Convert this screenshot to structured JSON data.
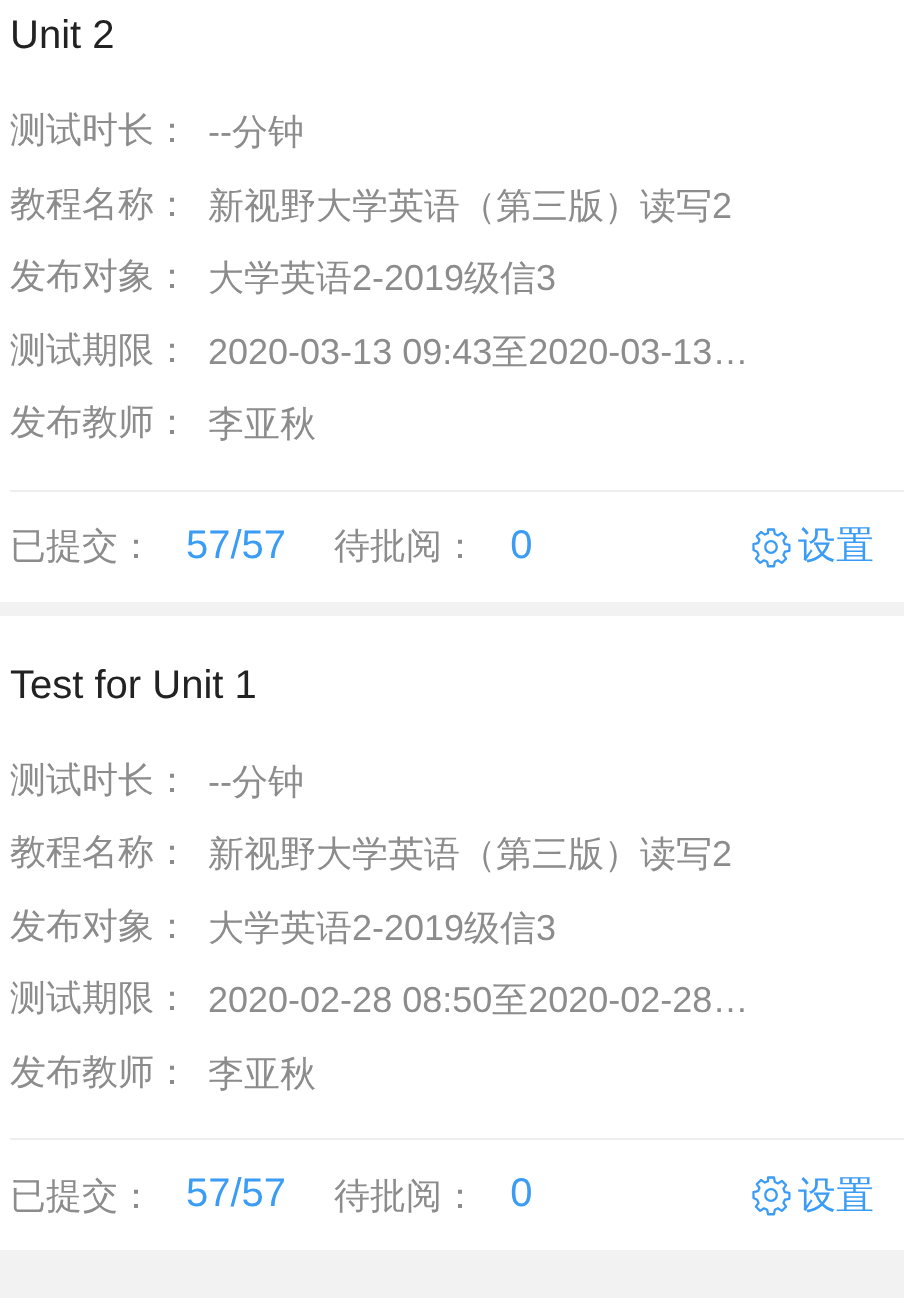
{
  "tests": [
    {
      "title": "Unit 2",
      "fields": [
        {
          "label": "测试时长：",
          "value": "--分钟"
        },
        {
          "label": "教程名称：",
          "value": "新视野大学英语（第三版）读写2"
        },
        {
          "label": "发布对象：",
          "value": "大学英语2-2019级信3"
        },
        {
          "label": "测试期限：",
          "value": "2020-03-13 09:43至2020-03-13…"
        },
        {
          "label": "发布教师：",
          "value": "李亚秋"
        }
      ],
      "submitted_label": "已提交：",
      "submitted": "57/57",
      "pending_label": "待批阅：",
      "pending": "0",
      "settings": "设置"
    },
    {
      "title": "Test for Unit 1",
      "fields": [
        {
          "label": "测试时长：",
          "value": "--分钟"
        },
        {
          "label": "教程名称：",
          "value": "新视野大学英语（第三版）读写2"
        },
        {
          "label": "发布对象：",
          "value": "大学英语2-2019级信3"
        },
        {
          "label": "测试期限：",
          "value": "2020-02-28 08:50至2020-02-28…"
        },
        {
          "label": "发布教师：",
          "value": "李亚秋"
        }
      ],
      "submitted_label": "已提交：",
      "submitted": "57/57",
      "pending_label": "待批阅：",
      "pending": "0",
      "settings": "设置"
    }
  ]
}
